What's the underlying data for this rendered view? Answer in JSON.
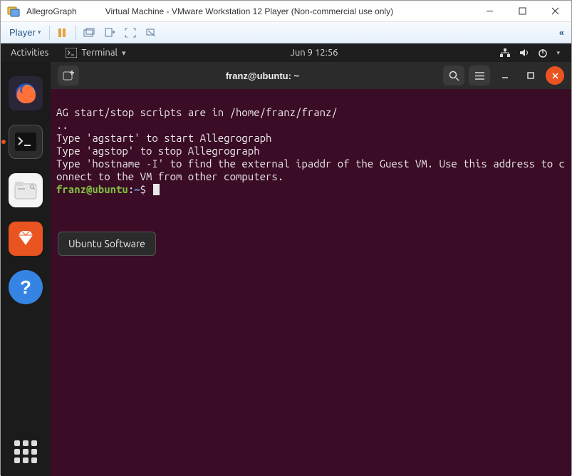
{
  "windows_titlebar": {
    "app_name": "AllegroGraph",
    "subtitle": "Virtual Machine - VMware Workstation 12 Player (Non-commercial use only)"
  },
  "vmware_toolbar": {
    "player_label": "Player"
  },
  "ubuntu_topbar": {
    "activities": "Activities",
    "app_indicator": "Terminal",
    "datetime": "Jun 9  12:56"
  },
  "dock": {
    "items": [
      "firefox",
      "terminal",
      "files",
      "software",
      "help"
    ],
    "tooltip": "Ubuntu Software"
  },
  "terminal": {
    "window_title": "franz@ubuntu: ~",
    "lines": [
      "AG start/stop scripts are in /home/franz/franz/",
      "..",
      "Type 'agstart' to start Allegrograph",
      "Type 'agstop' to stop Allegrograph",
      "Type 'hostname -I' to find the external ipaddr of the Guest VM. Use this address to connect to the VM from other computers."
    ],
    "prompt_user": "franz@ubuntu",
    "prompt_path": "~",
    "prompt_symbol": "$"
  }
}
